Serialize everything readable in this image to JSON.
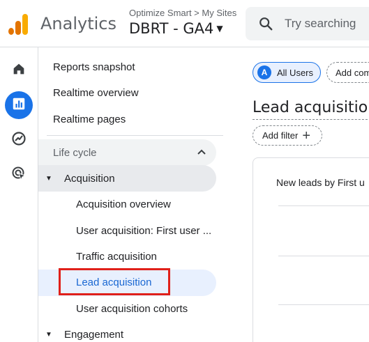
{
  "header": {
    "app_name": "Analytics",
    "account_path": "Optimize Smart > My Sites",
    "property_name": "DBRT - GA4",
    "search_placeholder": "Try searching"
  },
  "rail": {
    "items": [
      {
        "icon": "home-icon",
        "active": false
      },
      {
        "icon": "reports-icon",
        "active": true
      },
      {
        "icon": "explore-icon",
        "active": false
      },
      {
        "icon": "advertising-icon",
        "active": false
      }
    ]
  },
  "nav": {
    "top_items": [
      "Reports snapshot",
      "Realtime overview",
      "Realtime pages"
    ],
    "section_label": "Life cycle",
    "acquisition_label": "Acquisition",
    "acquisition_items": [
      "Acquisition overview",
      "User acquisition: First user ...",
      "Traffic acquisition",
      "Lead acquisition",
      "User acquisition cohorts"
    ],
    "selected_index": 3,
    "engagement_label": "Engagement"
  },
  "main": {
    "chip_avatar": "A",
    "chip_all_users": "All Users",
    "chip_add_comparison": "Add com",
    "page_title": "Lead acquisition",
    "add_filter_label": "Add filter",
    "card_title": "New leads by First u"
  },
  "colors": {
    "accent": "#1a73e8",
    "selected_bg": "#e8f0fe",
    "highlight_box": "#e0201a"
  }
}
